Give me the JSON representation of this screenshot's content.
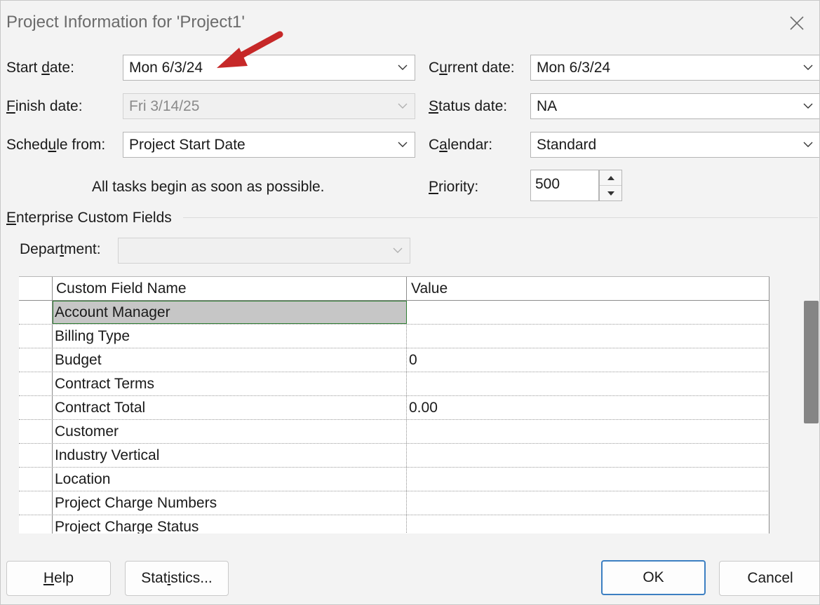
{
  "dialog": {
    "title": "Project Information for 'Project1'"
  },
  "fields": {
    "start_date": {
      "label_pre": "Start ",
      "label_ul": "d",
      "label_post": "ate:",
      "value": "Mon 6/3/24"
    },
    "finish_date": {
      "label_pre": "",
      "label_ul": "F",
      "label_post": "inish date:",
      "value": "Fri 3/14/25"
    },
    "schedule_from": {
      "label_pre": "Sched",
      "label_ul": "u",
      "label_post": "le from:",
      "value": "Project Start Date"
    },
    "current_date": {
      "label_pre": "C",
      "label_ul": "u",
      "label_post": "rrent date:",
      "value": "Mon 6/3/24"
    },
    "status_date": {
      "label_pre": "",
      "label_ul": "S",
      "label_post": "tatus date:",
      "value": "NA"
    },
    "calendar": {
      "label_pre": "C",
      "label_ul": "a",
      "label_post": "lendar:",
      "value": "Standard"
    },
    "priority": {
      "label_pre": "",
      "label_ul": "P",
      "label_post": "riority:",
      "value": "500"
    },
    "schedule_note": "All tasks begin as soon as possible."
  },
  "enterprise": {
    "section_pre": "",
    "section_ul": "E",
    "section_post": "nterprise Custom Fields",
    "department": {
      "label_pre": "Depar",
      "label_ul": "t",
      "label_post": "ment:",
      "value": ""
    },
    "columns": [
      "Custom Field Name",
      "Value"
    ],
    "rows": [
      {
        "name": "Account Manager",
        "value": ""
      },
      {
        "name": "Billing Type",
        "value": ""
      },
      {
        "name": "Budget",
        "value": "0"
      },
      {
        "name": "Contract Terms",
        "value": ""
      },
      {
        "name": "Contract Total",
        "value": "0.00"
      },
      {
        "name": "Customer",
        "value": ""
      },
      {
        "name": "Industry Vertical",
        "value": ""
      },
      {
        "name": "Location",
        "value": ""
      },
      {
        "name": "Project Charge Numbers",
        "value": ""
      },
      {
        "name": "Project Charge Status",
        "value": ""
      }
    ]
  },
  "buttons": {
    "help": {
      "pre": "",
      "ul": "H",
      "post": "elp"
    },
    "statistics": {
      "pre": "Stat",
      "ul": "i",
      "post": "stics..."
    },
    "ok": "OK",
    "cancel": "Cancel"
  },
  "colors": {
    "annotation_arrow": "#c62828",
    "selection_border": "#2e7d32",
    "default_button_border": "#3c7fc2"
  },
  "icons": [
    "close-icon",
    "chevron-down-icon",
    "spin-up-icon",
    "spin-down-icon",
    "annotation-arrow-icon"
  ]
}
